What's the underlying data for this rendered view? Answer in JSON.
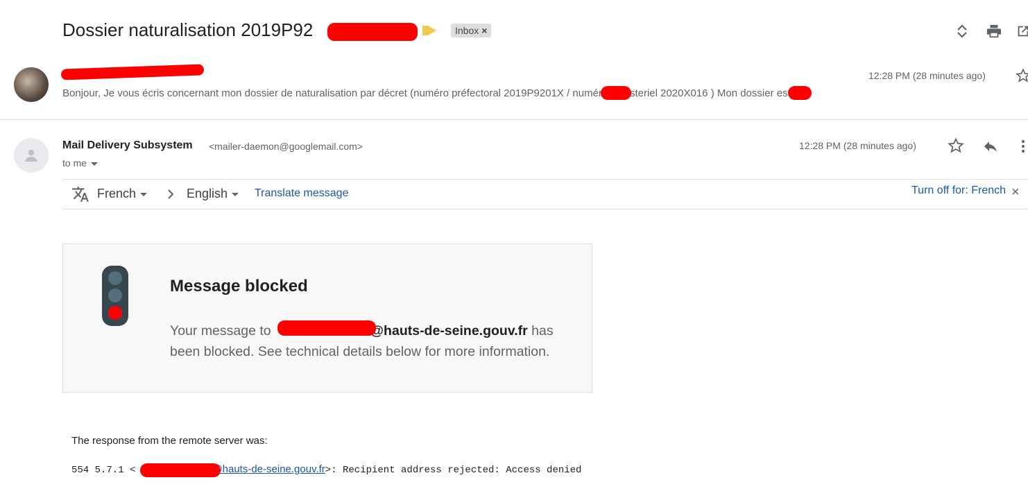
{
  "thread": {
    "subject": "Dossier naturalisation 2019P92",
    "label": "Inbox",
    "label_remove": "×"
  },
  "message1": {
    "time": "12:28 PM (28 minutes ago)",
    "snippet": "Bonjour, Je vous écris concernant mon dossier de naturalisation par décret (numéro préfectoral 2019P9201X        / numéro ministeriel 2020X016        ) Mon dossier est"
  },
  "message2": {
    "sender_name": "Mail Delivery Subsystem",
    "sender_email": "<mailer-daemon@googlemail.com>",
    "time": "12:28 PM (28 minutes ago)",
    "to_label": "to me"
  },
  "translate_bar": {
    "source_lang": "French",
    "target_lang": "English",
    "translate_label": "Translate message",
    "turn_off_label": "Turn off for: French",
    "close_label": "×"
  },
  "bounce_card": {
    "title": "Message blocked",
    "body_prefix": "Your message to ",
    "address_domain": "@hauts-de-seine.gouv.fr",
    "body_suffix": " has been blocked. See technical details below for more information."
  },
  "response": {
    "intro": "The response from the remote server was:",
    "code": "554 5.7.1 <",
    "address_link": "@hauts-de-seine.gouv.fr",
    "message": ">: Recipient address rejected: Access denied"
  },
  "icons": [
    "expand-collapse-icon",
    "print-icon",
    "open-in-new-window-icon",
    "star-icon",
    "reply-icon",
    "more-icon",
    "translate-icon",
    "chevron-right-icon",
    "traffic-light-icon",
    "person-icon"
  ],
  "colors": {
    "link": "#1a57b0",
    "importance_marker": "#f2c94c",
    "redaction": "#ff0000",
    "traffic_light_red": "#ff0000"
  }
}
